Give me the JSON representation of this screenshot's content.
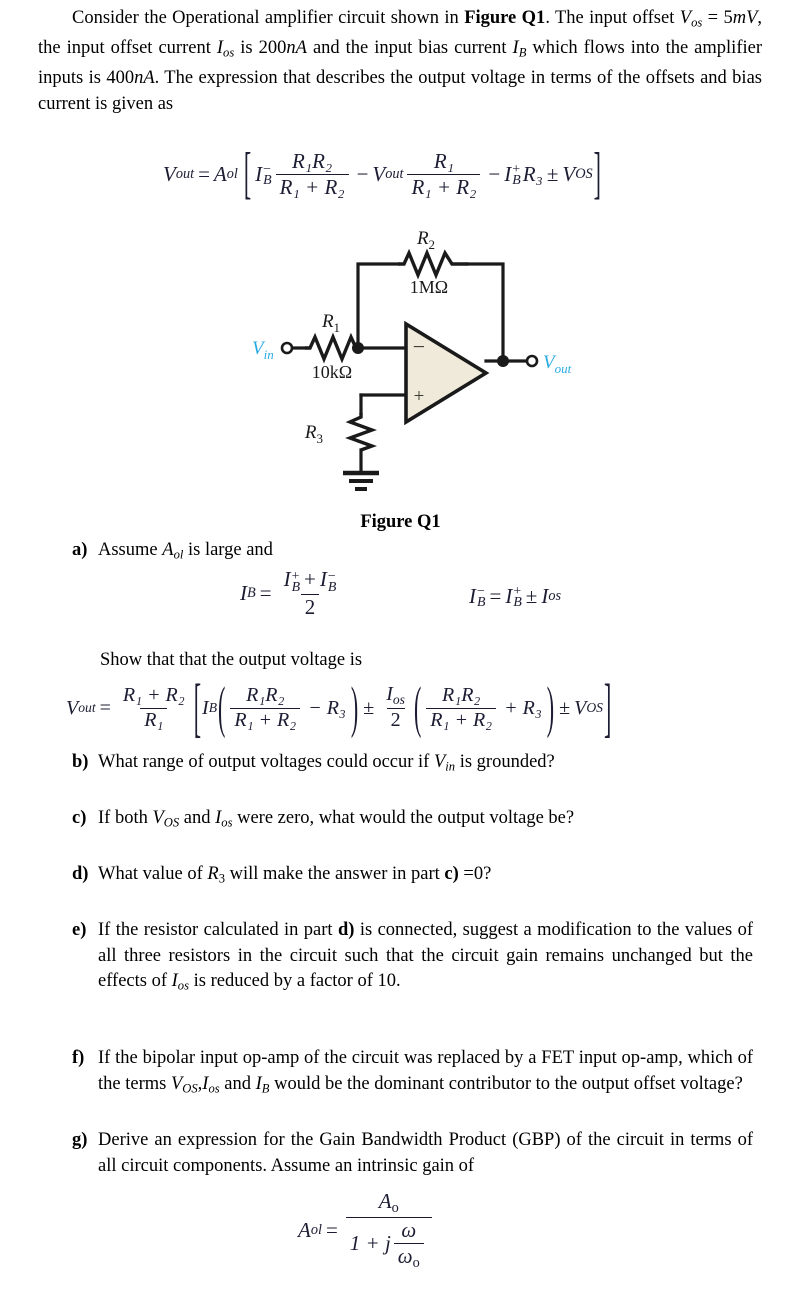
{
  "document": {
    "intro": {
      "line_text": "Consider the Operational amplifier circuit shown in Figure Q1. The input offset Vos = 5mV, the input offset current Ios is 200nA and the input bias current IB which flows into the amplifier inputs is 400nA. The expression that describes the output voltage in terms of the offsets and bias current is given as",
      "seg1": "Consider the Operational amplifier circuit shown in ",
      "figure_ref": "Figure Q1",
      "seg2": ". The input offset ",
      "vos_var": "V",
      "vos_sub": "os",
      "seg3": " = 5",
      "mv_unit": "mV",
      "seg4": ", the input offset current ",
      "ios_var": "I",
      "ios_sub": "os",
      "seg5": " is 200",
      "na_unit1": "nA",
      "seg6": " and the input bias current ",
      "ib_var": "I",
      "ib_sub": "B",
      "seg7": " which flows into the amplifier inputs is 400",
      "na_unit2": "nA",
      "seg8": ". The expression that describes the output voltage in terms of the offsets and bias current is given as"
    },
    "equations": {
      "main": {
        "lhs_var": "V",
        "lhs_sub": "out",
        "equals": "=",
        "aol_var": "A",
        "aol_sub": "ol",
        "bracket_open": "[",
        "ib_minus_var": "I",
        "ib_minus_sup": "−",
        "ib_minus_sub": "B",
        "frac1_num": "R₁R₂",
        "frac1_den": "R₁ + R₂",
        "minus1": "−",
        "vout_var": "V",
        "vout_sub": "out",
        "frac2_num": "R₁",
        "frac2_den": "R₁ + R₂",
        "minus2": "−",
        "ibp_var": "I",
        "ibp_sup": "+",
        "ibp_sub": "B",
        "r3": "R₃",
        "pm": "±",
        "vos_var": "V",
        "vos_sub": "OS",
        "bracket_close": "]"
      },
      "ib_average": {
        "lhs_var": "I",
        "lhs_sub": "B",
        "equals": "=",
        "num_plus": "I",
        "den": "2"
      },
      "ib_offset": {
        "equals": "=",
        "pm": "±",
        "ios_var": "I",
        "ios_sub": "os"
      },
      "show_that": {
        "lhs_var": "V",
        "lhs_sub": "out",
        "equals": "=",
        "gain_num": "R₁ + R₂",
        "gain_den": "R₁",
        "ib_var": "I",
        "ib_sub": "B",
        "f1_num": "R₁R₂",
        "f1_den": "R₁ + R₂",
        "minus_r3": "− R₃",
        "pm1": "±",
        "ios_num_var": "I",
        "ios_num_sub": "os",
        "ios_den": "2",
        "f2_num": "R₁R₂",
        "f2_den": "R₁ + R₂",
        "plus_r3": "+ R₃",
        "pm2": "±",
        "vos_var": "V",
        "vos_sub": "OS"
      },
      "aol_gain": {
        "lhs_var": "A",
        "lhs_sub": "ol",
        "equals": "=",
        "num_var": "A",
        "num_sub": "o",
        "den_prefix": "1 + j",
        "den_frac_num": "ω",
        "den_frac_den_var": "ω",
        "den_frac_den_sub": "o"
      }
    },
    "figure": {
      "caption": "Figure Q1",
      "labels": {
        "r1_name": "R",
        "r1_sub": "1",
        "r1_value": "10kΩ",
        "r2_name": "R",
        "r2_sub": "2",
        "r2_value": "1MΩ",
        "r3_name": "R",
        "r3_sub": "3",
        "vin_name": "V",
        "vin_sub": "in",
        "vout_name": "V",
        "vout_sub": "out",
        "inverting_sign": "−",
        "noninverting_sign": "+"
      },
      "colors": {
        "opamp_fill": "#EFEADA",
        "wire": "#1a1a1a",
        "node_label": "#29ABE2"
      }
    },
    "questions": [
      {
        "label": "a)",
        "text": "Assume Aol is large and",
        "prefix": "Assume ",
        "var": "A",
        "var_sub": "ol",
        "suffix": " is large and"
      },
      {
        "label": "",
        "text": "Show that that the output voltage is"
      },
      {
        "label": "b)",
        "prefix": "What range of output voltages could occur if ",
        "var": "V",
        "var_sub": "in",
        "suffix": " is grounded?"
      },
      {
        "label": "c)",
        "prefix": "If both ",
        "var": "V",
        "var_sub": "OS",
        "mid": " and ",
        "var2": "I",
        "var2_sub": "os",
        "suffix": " were zero, what would the output voltage be?"
      },
      {
        "label": "d)",
        "prefix": "What value of ",
        "var": "R",
        "var_sub": "3",
        "mid": " will make the answer in part ",
        "bold_ref": "c)",
        "suffix": " =0?"
      },
      {
        "label": "e)",
        "prefix": "If the resistor calculated in part ",
        "bold_ref": "d)",
        "mid": " is connected, suggest a modification to the values of all three resistors in the circuit such that the circuit gain remains unchanged but the effects of ",
        "var": "I",
        "var_sub": "os",
        "suffix": " is reduced by a factor of 10."
      },
      {
        "label": "f)",
        "prefix": "If the bipolar input op-amp of the circuit was replaced by a FET input op-amp, which of the terms ",
        "var": "V",
        "var_sub": "OS",
        "comma": ",",
        "var2": "I",
        "var2_sub": "os",
        "mid": " and ",
        "var3": "I",
        "var3_sub": "B",
        "suffix": " would be the dominant contributor to the output offset voltage?"
      },
      {
        "label": "g)",
        "text": "Derive an expression for the Gain Bandwidth Product (GBP) of the circuit in terms of all circuit components. Assume an intrinsic gain of"
      }
    ]
  }
}
